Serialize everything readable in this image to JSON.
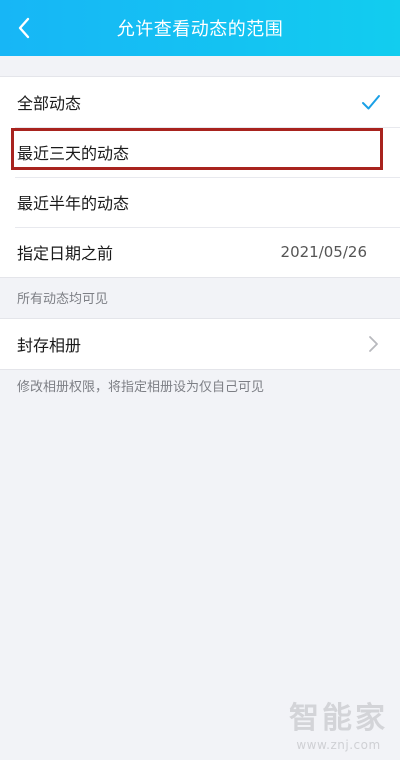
{
  "header": {
    "title": "允许查看动态的范围"
  },
  "options": [
    {
      "label": "全部动态",
      "value": "",
      "selected": true
    },
    {
      "label": "最近三天的动态",
      "value": "",
      "selected": false
    },
    {
      "label": "最近半年的动态",
      "value": "",
      "selected": false
    },
    {
      "label": "指定日期之前",
      "value": "2021/05/26",
      "selected": false
    }
  ],
  "notes": {
    "visibility_note": "所有动态均可见",
    "archive_note": "修改相册权限，将指定相册设为仅自己可见"
  },
  "archive": {
    "label": "封存相册"
  },
  "watermark": {
    "text": "智能家",
    "url": "www.znj.com"
  },
  "colors": {
    "header_start": "#17b6f6",
    "header_end": "#12cdef",
    "check": "#1aa0e6",
    "highlight": "#a8231e"
  }
}
